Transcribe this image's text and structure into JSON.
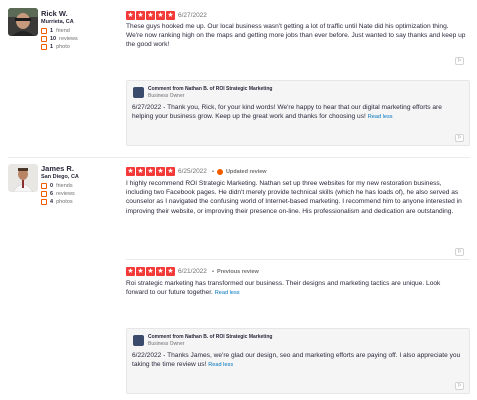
{
  "reviews": [
    {
      "user": {
        "name": "Rick W.",
        "location": "Murrieta, CA",
        "friends": "1",
        "friends_label": "friend",
        "reviews": "10",
        "reviews_label": "reviews",
        "photos": "1",
        "photos_label": "photo"
      },
      "stars": 5,
      "date": "6/27/2022",
      "text": "These guys hooked me up. Our local business wasn't getting a lot of traffic until Nate did his optimization thing. We're now ranking high on the maps and getting more jobs than ever before. Just wanted to say thanks and keep up the good work!",
      "owner_reply": {
        "title": "Comment from Nathan B. of ROI Strategic Marketing",
        "subtitle": "Business Owner",
        "date": "6/27/2022",
        "separator": " - ",
        "text": "Thank you, Rick, for your kind words! We're happy to hear that our digital marketing efforts are helping your business grow. Keep up the great work and thanks for choosing us!",
        "read_less": "Read less"
      }
    },
    {
      "user": {
        "name": "James R.",
        "location": "San Diego, CA",
        "friends": "0",
        "friends_label": "friends",
        "reviews": "6",
        "reviews_label": "reviews",
        "photos": "4",
        "photos_label": "photos"
      },
      "stars": 5,
      "date": "6/25/2022",
      "badge": "Updated review",
      "text": "I highly recommend ROI Strategic Marketing. Nathan set up three websites for my new restoration business, including two Facebook pages. He didn't merely provide technical skills (which he has loads of), he also served as  counselor as I navigated the confusing world of Internet-based marketing. I recommend him to anyone interested in improving their website, or improving their presence on-line. His professionalism and dedication are outstanding.",
      "previous": {
        "stars": 5,
        "date": "6/21/2022",
        "badge": "Previous review",
        "text": "Roi strategic marketing has transformed our business. Their designs and marketing tactics are unique. Look forward to our future together.",
        "read_less": "Read less"
      },
      "owner_reply": {
        "title": "Comment from Nathan B. of ROI Strategic Marketing",
        "subtitle": "Business Owner",
        "date": "6/22/2022",
        "separator": " - ",
        "text": "Thanks James, we're glad our design, seo and marketing efforts are paying off. I also appreciate you taking the time review us!",
        "read_less": "Read less"
      }
    }
  ],
  "icons": {
    "star": "star-icon",
    "flag": "flag-icon",
    "friends": "friends-icon",
    "reviews": "reviews-icon",
    "photos": "photos-icon",
    "updated": "updated-review-icon",
    "previous": "previous-review-icon"
  },
  "colors": {
    "star": "#f43939",
    "stat_icon": "#f15c00",
    "link": "#0073bb"
  },
  "flag_glyph": "⚐",
  "star_glyph": "★",
  "dot": "•"
}
